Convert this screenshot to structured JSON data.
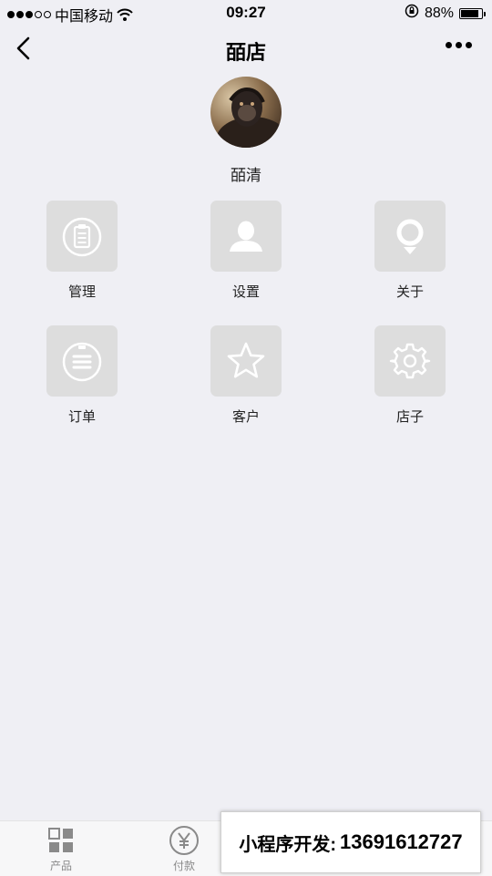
{
  "status_bar": {
    "carrier": "中国移动",
    "time": "09:27",
    "battery": "88%",
    "battery_level": 0.88
  },
  "nav": {
    "title": "皕店",
    "back_icon": "chevron-left-icon",
    "more_icon": "more-dots-icon"
  },
  "profile": {
    "name": "皕清"
  },
  "grid": [
    {
      "label": "管理",
      "icon": "clipboard-icon"
    },
    {
      "label": "设置",
      "icon": "user-icon"
    },
    {
      "label": "关于",
      "icon": "location-pin-icon"
    },
    {
      "label": "订单",
      "icon": "list-icon"
    },
    {
      "label": "客户",
      "icon": "star-icon"
    },
    {
      "label": "店子",
      "icon": "gear-icon"
    }
  ],
  "tabs": [
    {
      "label": "产品",
      "icon": "grid-icon"
    },
    {
      "label": "付款",
      "icon": "yen-icon"
    }
  ],
  "promo": {
    "label": "小程序开发:",
    "phone": "13691612727"
  },
  "colors": {
    "background": "#efeff4",
    "tile": "#dddddd",
    "tab_bar": "#f7f7f8"
  }
}
